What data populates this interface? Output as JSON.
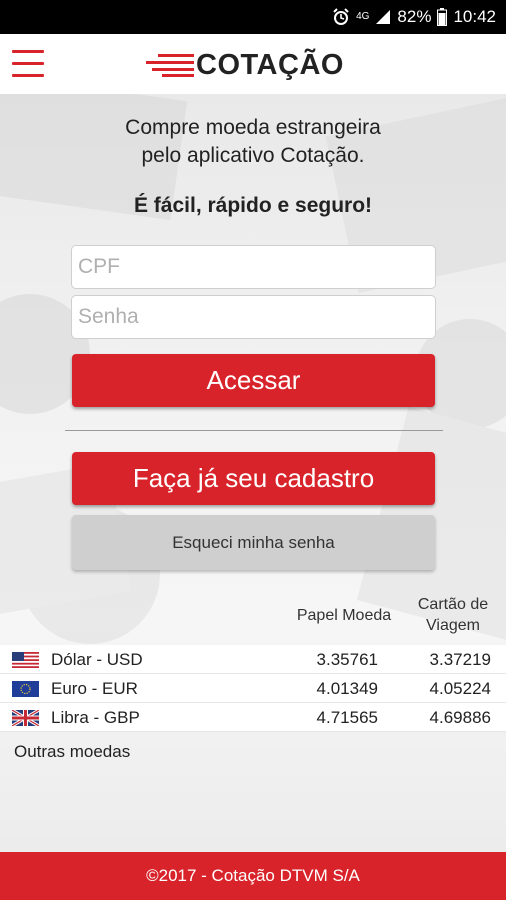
{
  "status_bar": {
    "network": "4G",
    "battery": "82%",
    "time": "10:42"
  },
  "header": {
    "logo_text": "COTAÇÃO",
    "brand_color": "#d9232a"
  },
  "intro": {
    "line1": "Compre moeda estrangeira",
    "line2": "pelo aplicativo Cotação.",
    "tagline": "É fácil, rápido e seguro!"
  },
  "login": {
    "cpf_placeholder": "CPF",
    "password_placeholder": "Senha",
    "access_label": "Acessar",
    "register_label": "Faça já seu cadastro",
    "forgot_label": "Esqueci minha senha"
  },
  "rates": {
    "columns": [
      "Papel Moeda",
      "Cartão de",
      "Viagem"
    ],
    "rows": [
      {
        "currency": "Dólar - USD",
        "flag": "us-flag-icon",
        "papel": "3.35761",
        "cartao": "3.37219"
      },
      {
        "currency": "Euro - EUR",
        "flag": "eu-flag-icon",
        "papel": "4.01349",
        "cartao": "4.05224"
      },
      {
        "currency": "Libra - GBP",
        "flag": "uk-flag-icon",
        "papel": "4.71565",
        "cartao": "4.69886"
      }
    ],
    "others_label": "Outras moedas"
  },
  "footer": {
    "text": "©2017 - Cotação DTVM S/A"
  }
}
